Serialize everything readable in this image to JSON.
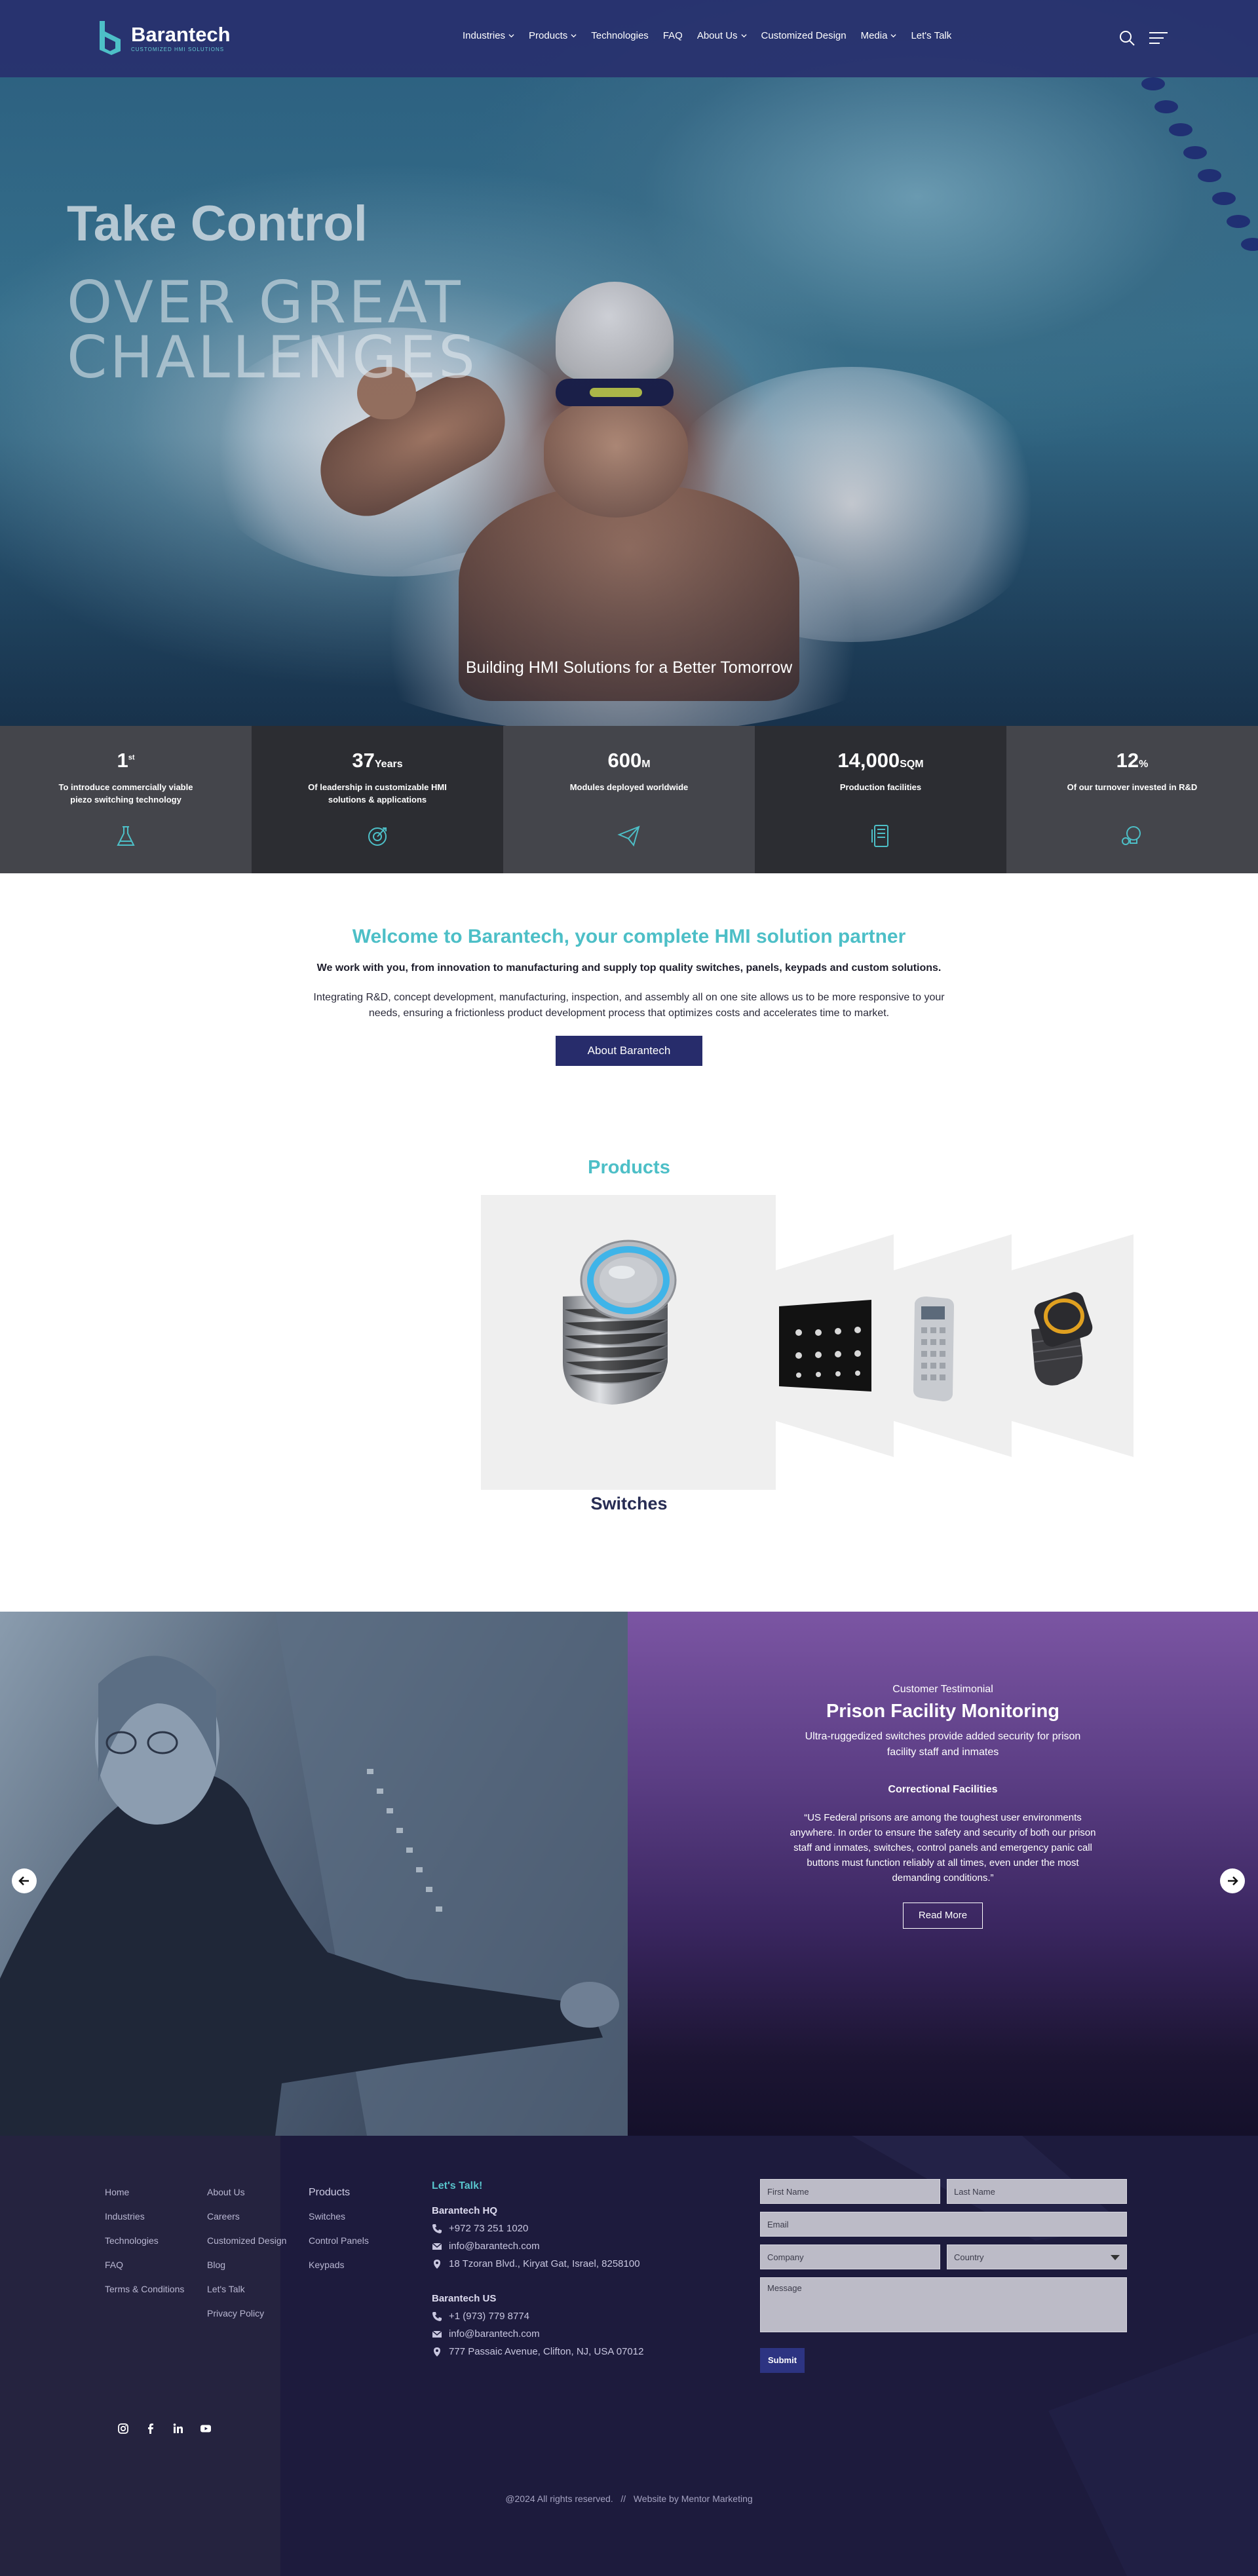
{
  "header": {
    "brand": "Barantech",
    "tagline": "CUSTOMIZED HMI SOLUTIONS",
    "nav": [
      {
        "label": "Industries",
        "dropdown": true
      },
      {
        "label": "Products",
        "dropdown": true
      },
      {
        "label": "Technologies",
        "dropdown": false
      },
      {
        "label": "FAQ",
        "dropdown": false
      },
      {
        "label": "About Us",
        "dropdown": true
      },
      {
        "label": "Customized Design",
        "dropdown": false
      },
      {
        "label": "Media",
        "dropdown": true
      },
      {
        "label": "Let's Talk",
        "dropdown": false
      }
    ],
    "icons": [
      "search-icon",
      "menu-icon"
    ]
  },
  "hero": {
    "title_1": "Take Control",
    "title_2": "OVER GREAT CHALLENGES",
    "subtitle": "Building HMI Solutions for a Better Tomorrow"
  },
  "stats": [
    {
      "number": "1",
      "unit": "st",
      "description": "To introduce commercially viable piezo switching technology",
      "icon": "flask-icon"
    },
    {
      "number": "37",
      "unit": "Years",
      "description": "Of leadership in customizable HMI solutions & applications",
      "icon": "target-icon"
    },
    {
      "number": "600",
      "unit": "M",
      "description": "Modules deployed worldwide",
      "icon": "paper-plane-icon"
    },
    {
      "number": "14,000",
      "unit": "SQM",
      "description": "Production facilities",
      "icon": "device-icon"
    },
    {
      "number": "12",
      "unit": "%",
      "description": "Of our turnover invested in R&D",
      "icon": "bulb-icon"
    }
  ],
  "welcome": {
    "title": "Welcome to Barantech, your complete HMI solution partner",
    "bold_line": "We work with you, from innovation to manufacturing and supply top quality switches, panels, keypads and custom solutions.",
    "text": "Integrating R&D, concept development, manufacturing, inspection, and assembly all on one site allows us to be more responsive to your needs, ensuring a frictionless product development process that optimizes costs and accelerates time to market.",
    "button": "About Barantech"
  },
  "products": {
    "title": "Products",
    "active_label": "Switches",
    "items": [
      "switch",
      "control-panel",
      "keypad",
      "rotary-switch"
    ]
  },
  "testimonial": {
    "kicker": "Customer Testimonial",
    "title": "Prison Facility Monitoring",
    "subtitle": "Ultra-ruggedized switches provide added security for prison facility staff and inmates",
    "category": "Correctional Facilities",
    "quote": "“US Federal prisons are among the toughest user environments anywhere. In order to ensure the safety and security of both our prison staff and inmates, switches, control panels and emergency panic call buttons must function reliably at all times, even under the most demanding conditions.”",
    "button": "Read More"
  },
  "footer": {
    "col1": [
      "Home",
      "Industries",
      "Technologies",
      "FAQ",
      "Terms & Conditions"
    ],
    "col2": [
      "About Us",
      "Careers",
      "Customized Design",
      "Blog",
      "Let's Talk",
      "Privacy Policy"
    ],
    "col3_heading": "Products",
    "col3": [
      "Switches",
      "Control Panels",
      "Keypads"
    ],
    "talk": {
      "title": "Let's Talk!",
      "hq_heading": "Barantech HQ",
      "hq_phone": "+972 73 251 1020",
      "hq_email": "info@barantech.com",
      "hq_address": "18 Tzoran Blvd., Kiryat Gat, Israel, 8258100",
      "us_heading": "Barantech US",
      "us_phone": "+1 (973) 779 8774",
      "us_email": "info@barantech.com",
      "us_address": "777 Passaic Avenue, Clifton, NJ, USA 07012"
    },
    "form": {
      "first_name": "First Name",
      "last_name": "Last Name",
      "email": "Email",
      "company": "Company",
      "country": "Country",
      "message": "Message",
      "submit": "Submit"
    },
    "socials": [
      "instagram-icon",
      "facebook-icon",
      "linkedin-icon",
      "youtube-icon"
    ],
    "copyright": "@2024 All rights reserved.",
    "separator": "//",
    "credit": "Website by Mentor Marketing"
  },
  "colors": {
    "header_bg": "#28306e",
    "accent_teal": "#4dbfc7",
    "navy_button": "#272c6b",
    "stat_light": "#44454b",
    "stat_dark": "#2c2d32",
    "testimonial_purple": "#7b55a3",
    "footer_bg": "#1d1b3d"
  }
}
